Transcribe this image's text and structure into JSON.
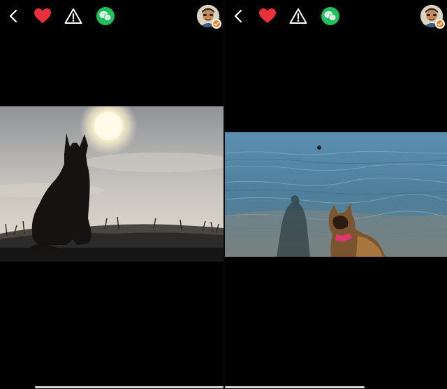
{
  "panels": [
    {
      "id": "left",
      "toolbar": {
        "back": "back-icon",
        "like": "heart-icon",
        "report": "warning-icon",
        "share": "wechat-icon"
      },
      "video": {
        "description_icon": "dog-silhouette-at-sunrise"
      }
    },
    {
      "id": "right",
      "toolbar": {
        "back": "back-icon",
        "like": "heart-icon",
        "report": "warning-icon",
        "share": "wechat-icon"
      },
      "video": {
        "description_icon": "dog-at-lake-shore"
      }
    }
  ],
  "colors": {
    "background": "#000000",
    "heart": "#e8303a",
    "wechat_green": "#1fc05b",
    "badge_orange": "#f07c1e",
    "icon_white": "#ffffff"
  }
}
